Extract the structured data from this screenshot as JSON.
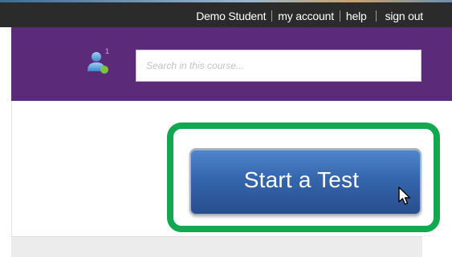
{
  "topnav": {
    "user_name": "Demo Student",
    "my_account": "my account",
    "help": "help",
    "sign_out": "sign out"
  },
  "header": {
    "user_icon": "user-icon",
    "user_count": "1",
    "search_placeholder": "Search in this course..."
  },
  "main": {
    "start_test_label": "Start a Test",
    "cursor_icon": "pointer-arrow-icon"
  },
  "colors": {
    "header_purple": "#5b2a79",
    "topbar_dark": "#2b2b2b",
    "button_blue": "#3566ad",
    "highlight_green": "#12a84f"
  }
}
